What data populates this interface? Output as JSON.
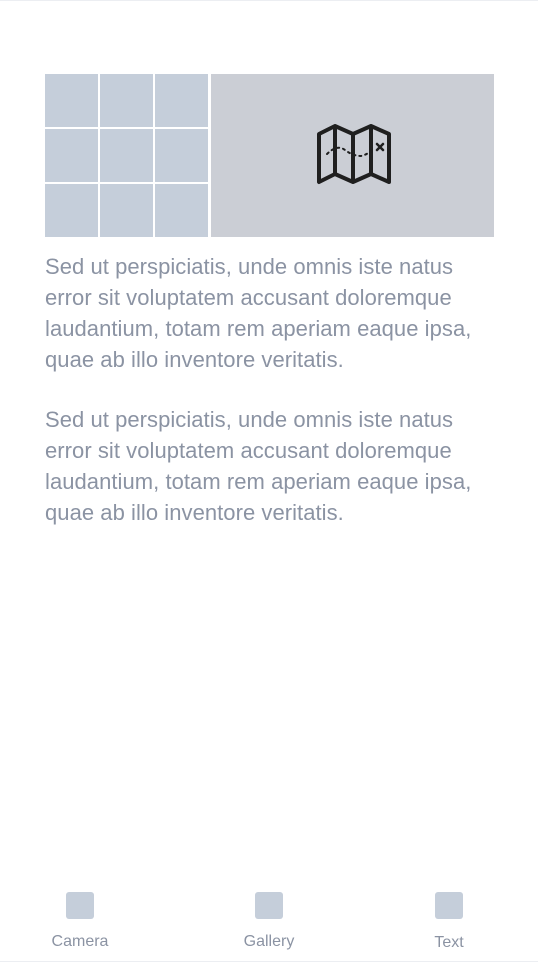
{
  "content": {
    "paragraphs": [
      "Sed ut perspiciatis, unde omnis iste natus error sit voluptatem accusant doloremque laudantium, totam rem aperiam eaque ipsa, quae ab illo inventore veritatis.",
      "Sed ut perspiciatis, unde omnis iste natus error sit voluptatem accusant doloremque laudantium, totam rem aperiam eaque ipsa, quae ab illo inventore veritatis."
    ]
  },
  "media": {
    "grid_icon": "grid-image-placeholder",
    "map_icon": "folded-map-icon"
  },
  "bottom_nav": {
    "items": [
      {
        "label": "Camera",
        "icon": "camera-icon"
      },
      {
        "label": "Gallery",
        "icon": "gallery-icon"
      },
      {
        "label": "Text",
        "icon": "text-icon"
      }
    ]
  },
  "colors": {
    "placeholder_blue": "#c5ceda",
    "placeholder_gray": "#cbced5",
    "text_gray": "#8b93a3",
    "icon_dark": "#1f1f1f"
  }
}
